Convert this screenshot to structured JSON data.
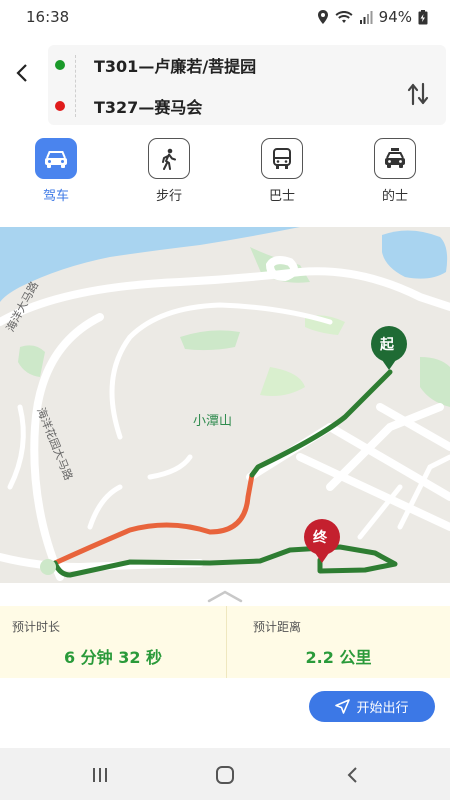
{
  "status_bar": {
    "time": "16:38",
    "battery": "94%"
  },
  "route": {
    "start": "T301—卢廉若/菩提园",
    "end": "T327—赛马会"
  },
  "modes": [
    {
      "label": "驾车",
      "icon": "car-icon",
      "active": true
    },
    {
      "label": "步行",
      "icon": "walk-icon",
      "active": false
    },
    {
      "label": "巴士",
      "icon": "bus-icon",
      "active": false
    },
    {
      "label": "的士",
      "icon": "taxi-icon",
      "active": false
    }
  ],
  "map": {
    "start_marker": "起",
    "end_marker": "终",
    "hill_label": "小潭山",
    "road_label_1": "海洋大马路",
    "road_label_2": "海洋花园大马路",
    "route_color": "#2e7d32",
    "congestion_color": "#e8643c"
  },
  "summary": {
    "duration_title": "预计时长",
    "duration_value": "6 分钟 32 秒",
    "distance_title": "预计距离",
    "distance_value": "2.2 公里"
  },
  "start_button": "开始出行",
  "accent_color": "#3c78e6"
}
